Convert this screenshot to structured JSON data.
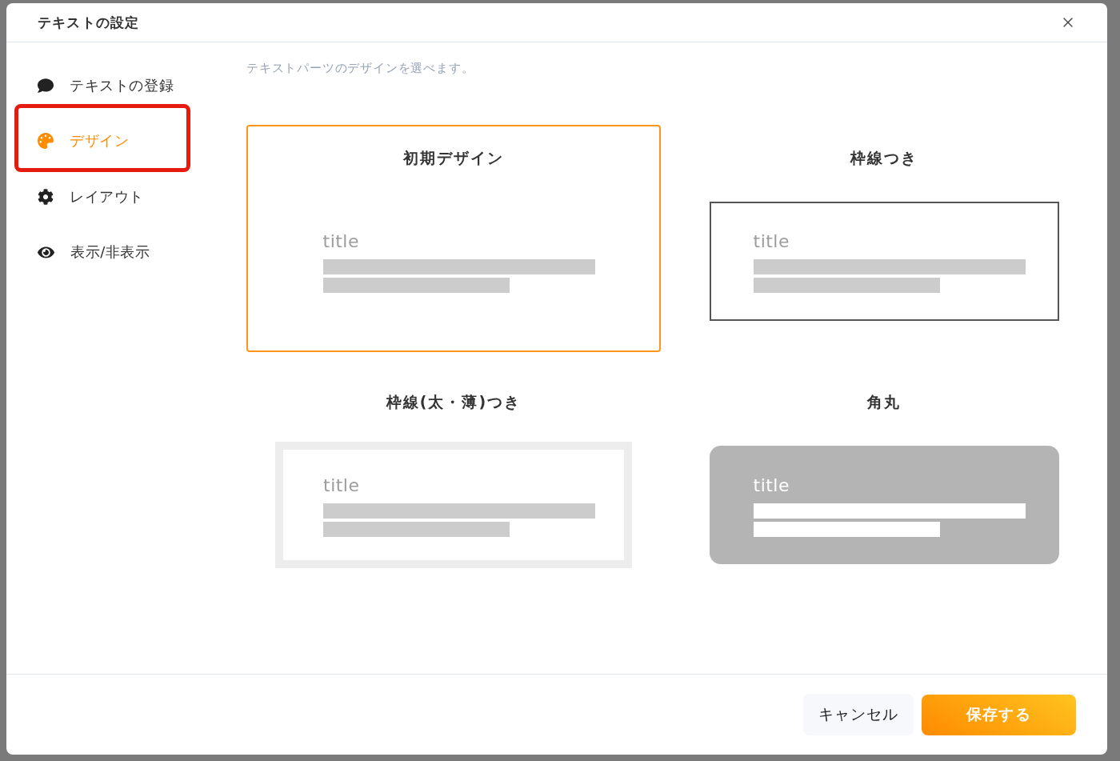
{
  "dialog": {
    "title": "テキストの設定"
  },
  "sidebar": {
    "items": [
      {
        "label": "テキストの登録",
        "selected": false,
        "highlighted": false
      },
      {
        "label": "デザイン",
        "selected": true,
        "highlighted": true
      },
      {
        "label": "レイアウト",
        "selected": false,
        "highlighted": false
      },
      {
        "label": "表示/非表示",
        "selected": false,
        "highlighted": false
      }
    ]
  },
  "description": "テキストパーツのデザインを選べます。",
  "designs": [
    {
      "title": "初期デザイン",
      "kind": "plain",
      "selected": true,
      "preview_title": "title"
    },
    {
      "title": "枠線つき",
      "kind": "border",
      "selected": false,
      "preview_title": "title"
    },
    {
      "title": "枠線(太・薄)つき",
      "kind": "thick_border",
      "selected": false,
      "preview_title": "title"
    },
    {
      "title": "角丸",
      "kind": "rounded",
      "selected": false,
      "preview_title": "title"
    }
  ],
  "footer": {
    "buttons": [
      {
        "label": "キャンセル",
        "kind": "secondary"
      },
      {
        "label": "保存する",
        "kind": "primary"
      }
    ]
  }
}
